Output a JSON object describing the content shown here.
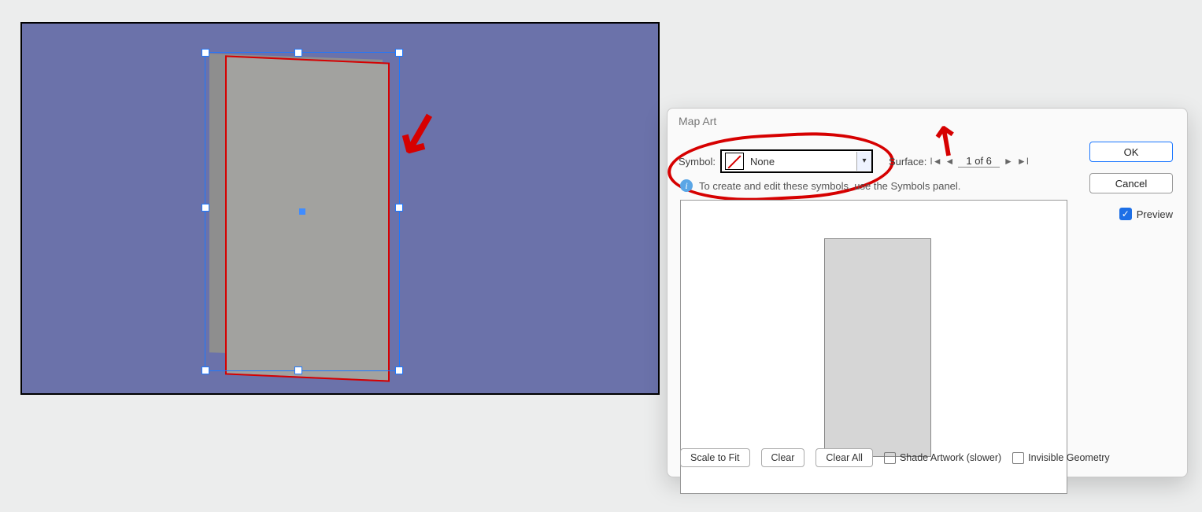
{
  "dialog": {
    "title": "Map Art",
    "symbol_label": "Symbol:",
    "symbol_value": "None",
    "surface_label": "Surface:",
    "surface_value": "1 of 6",
    "info_text": "To create and edit these symbols, use the Symbols panel.",
    "buttons": {
      "ok": "OK",
      "cancel": "Cancel"
    },
    "preview_label": "Preview",
    "preview_checked": true,
    "bottom": {
      "scale_fit": "Scale to Fit",
      "clear": "Clear",
      "clear_all": "Clear All",
      "shade_label": "Shade Artwork (slower)",
      "shade_checked": false,
      "invisible_label": "Invisible Geometry",
      "invisible_checked": false
    }
  }
}
